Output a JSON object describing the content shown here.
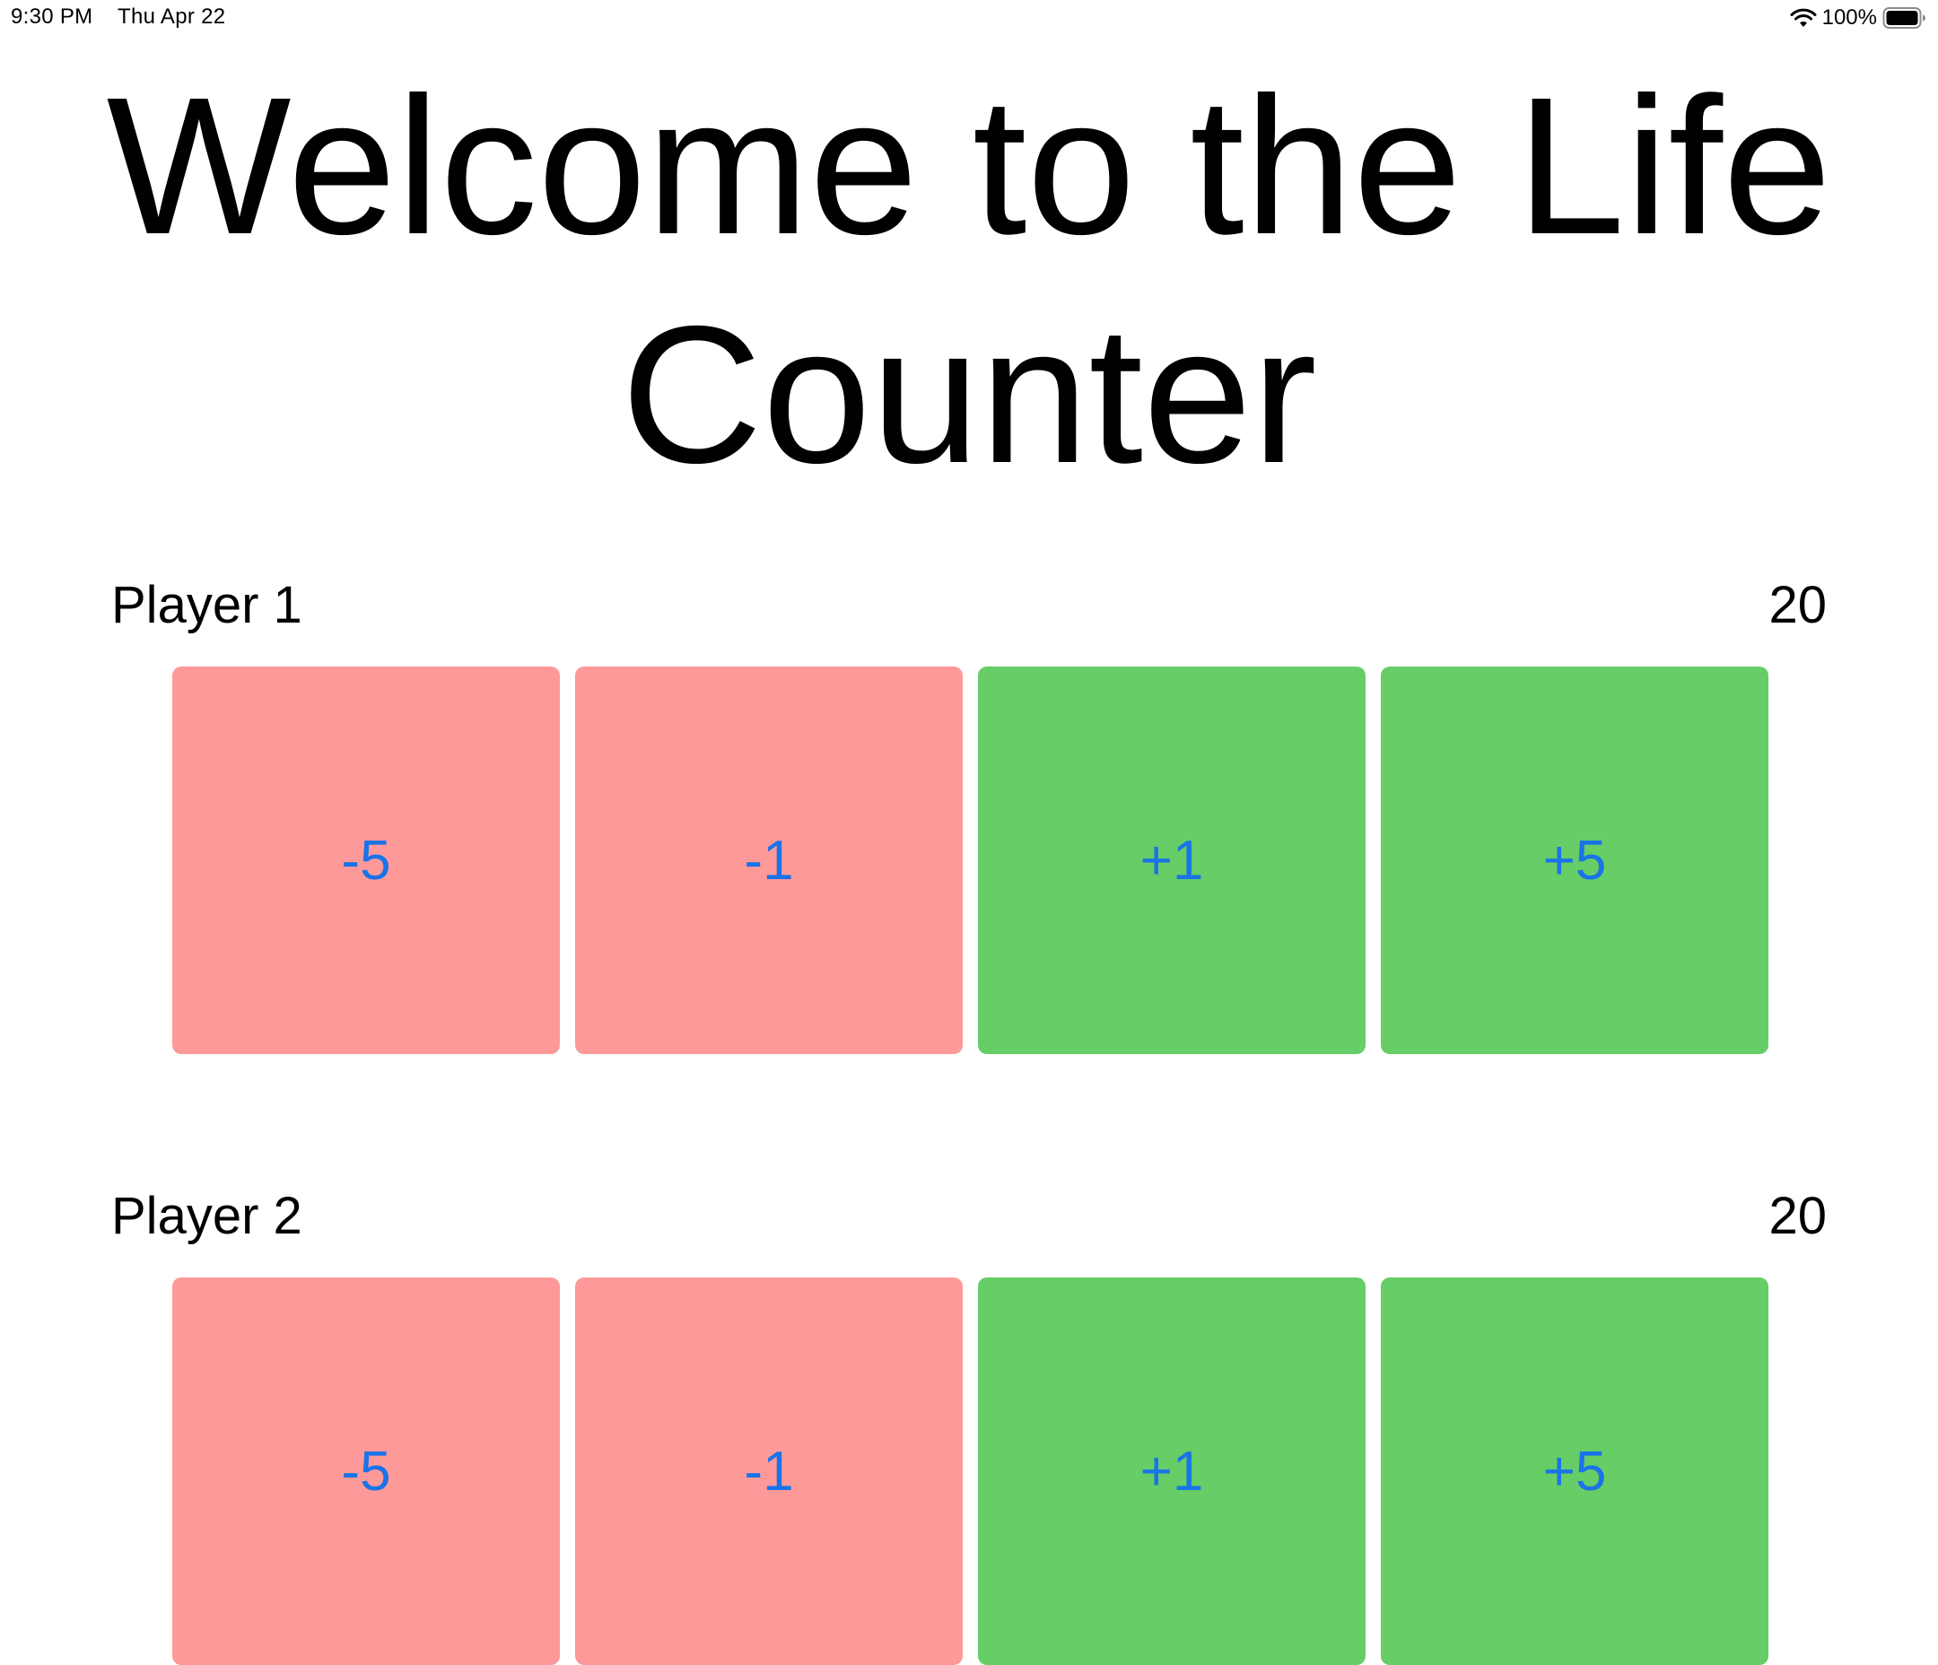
{
  "status_bar": {
    "time": "9:30 PM",
    "date": "Thu Apr 22",
    "battery_percent": "100%",
    "wifi_icon": "wifi-icon",
    "battery_icon": "battery-icon"
  },
  "title": "Welcome to the Life Counter",
  "colors": {
    "decrement_bg": "#fd9a99",
    "increment_bg": "#66cd67",
    "button_text": "#1a73e8"
  },
  "players": [
    {
      "name": "Player 1",
      "life": "20",
      "buttons": [
        "-5",
        "-1",
        "+1",
        "+5"
      ]
    },
    {
      "name": "Player 2",
      "life": "20",
      "buttons": [
        "-5",
        "-1",
        "+1",
        "+5"
      ]
    }
  ]
}
